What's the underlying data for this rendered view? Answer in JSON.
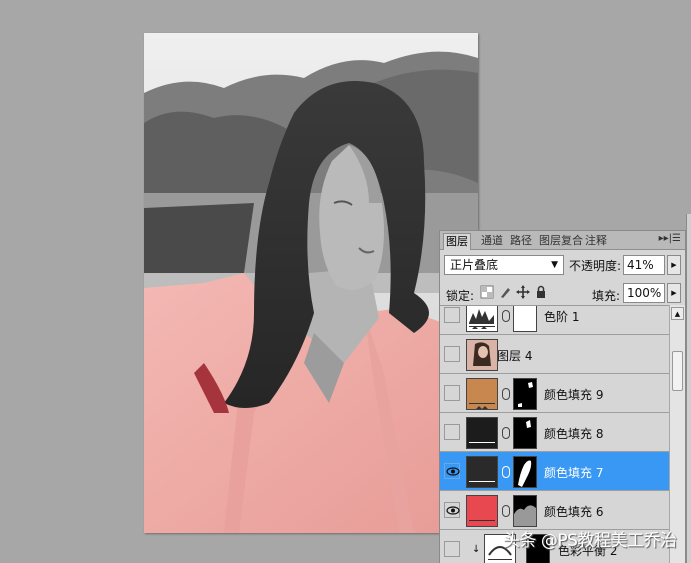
{
  "panel": {
    "tabs": [
      {
        "label": "图层",
        "active": true
      },
      {
        "label": "通道",
        "active": false
      },
      {
        "label": "路径",
        "active": false
      },
      {
        "label": "图层复合",
        "active": false
      },
      {
        "label": "注释",
        "active": false
      }
    ],
    "tab_menu": "▸▸|☰",
    "blend_mode": "正片叠底",
    "opacity_label": "不透明度:",
    "opacity_value": "41%",
    "lock_label": "锁定:",
    "fill_label": "填充:",
    "fill_value": "100%"
  },
  "layers": [
    {
      "name": "色阶 1",
      "kind": "adjustment",
      "visible": false,
      "selected": false
    },
    {
      "name": "图层 4",
      "kind": "image",
      "visible": false,
      "selected": false
    },
    {
      "name": "颜色填充 9",
      "kind": "fill",
      "color": "#c8874f",
      "visible": false,
      "selected": false
    },
    {
      "name": "颜色填充 8",
      "kind": "fill",
      "color": "#1c1c1c",
      "visible": false,
      "selected": false
    },
    {
      "name": "颜色填充 7",
      "kind": "fill",
      "color": "#2a2a2a",
      "visible": true,
      "selected": true
    },
    {
      "name": "颜色填充 6",
      "kind": "fill",
      "color": "#e8484f",
      "visible": true,
      "selected": false
    },
    {
      "name": "色彩平衡 2",
      "kind": "adjustment",
      "visible": false,
      "selected": false
    }
  ],
  "watermark": "头条 @PS教程美工乔治",
  "colors": {
    "selection": "#3a98f5",
    "panel_bg": "#d6d6d6",
    "workspace_bg": "#a7a7a7",
    "shirt_pink": "#f1b0ac"
  }
}
